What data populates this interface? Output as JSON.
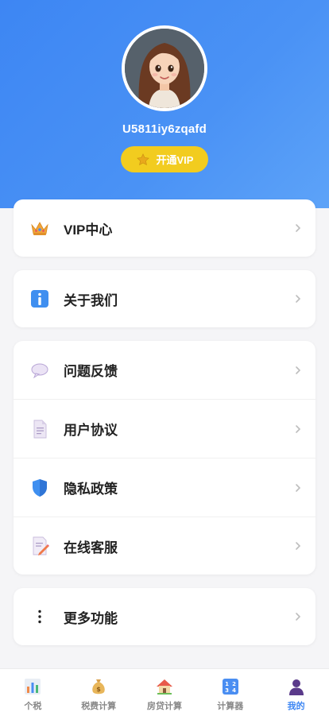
{
  "profile": {
    "username": "U5811iy6zqafd",
    "vip_button_label": "开通VIP"
  },
  "menu": {
    "vip_center": "VIP中心",
    "about_us": "关于我们",
    "feedback": "问题反馈",
    "user_agreement": "用户协议",
    "privacy_policy": "隐私政策",
    "online_service": "在线客服",
    "more_features": "更多功能"
  },
  "tabbar": {
    "tax": "个税",
    "fees": "税费计算",
    "mortgage": "房贷计算",
    "calculator": "计算器",
    "mine": "我的",
    "active_tab": "我的"
  },
  "icons": {
    "vip_center": "crown-icon",
    "about_us": "info-icon",
    "feedback": "speech-bubble-icon",
    "user_agreement": "document-icon",
    "privacy_policy": "shield-icon",
    "online_service": "memo-icon",
    "more_features": "vertical-ellipsis-icon"
  },
  "colors": {
    "header_gradient_start": "#3d86f3",
    "header_gradient_end": "#5da3f8",
    "vip_button": "#f2cc1f",
    "active_tab": "#3d86f3",
    "chevron": "#bdbdbd"
  }
}
